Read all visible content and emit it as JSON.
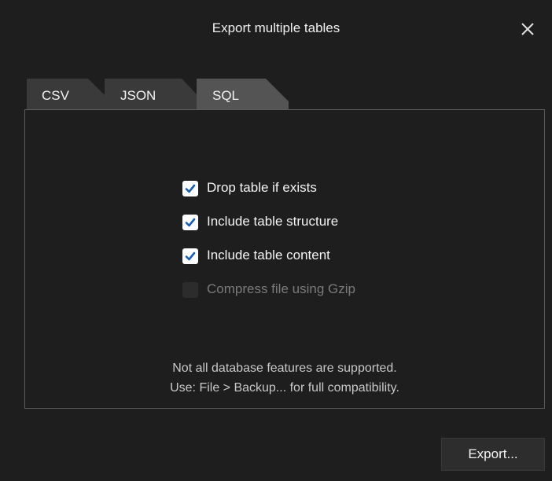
{
  "dialog": {
    "title": "Export multiple tables",
    "close_icon": "close-icon"
  },
  "tabs": [
    {
      "label": "CSV",
      "selected": false
    },
    {
      "label": "JSON",
      "selected": false
    },
    {
      "label": "SQL",
      "selected": true
    }
  ],
  "options": [
    {
      "label": "Drop table if exists",
      "checked": true,
      "enabled": true
    },
    {
      "label": "Include table structure",
      "checked": true,
      "enabled": true
    },
    {
      "label": "Include table content",
      "checked": true,
      "enabled": true
    },
    {
      "label": "Compress file using Gzip",
      "checked": false,
      "enabled": false
    }
  ],
  "note": {
    "line1": "Not all database features are supported.",
    "line2": "Use: File > Backup... for full compatibility."
  },
  "export_button": {
    "label": "Export..."
  },
  "colors": {
    "background": "#1e1e1e",
    "tab_inactive": "#3a3a3a",
    "tab_selected": "#545454",
    "checkbox_checked": "#ffffff",
    "checkmark": "#1a5fb4",
    "panel_border": "#5a5a5a"
  }
}
